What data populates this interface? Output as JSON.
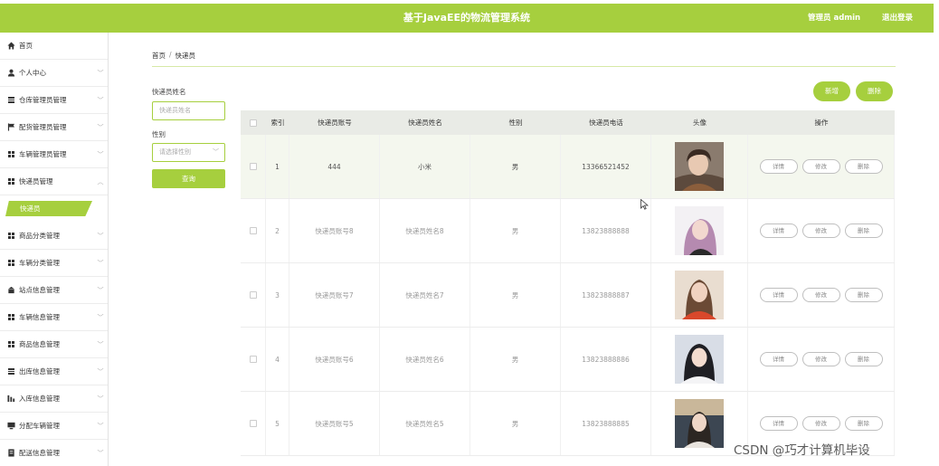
{
  "header": {
    "title": "基于JavaEE的物流管理系统",
    "admin_label": "管理员 admin",
    "logout_label": "退出登录",
    "bg_color": "#a6cf3e"
  },
  "sidebar": {
    "items": [
      {
        "label": "首页",
        "icon": "home-icon",
        "chevron": ""
      },
      {
        "label": "个人中心",
        "icon": "user-icon",
        "chevron": "﹀"
      },
      {
        "label": "仓库管理员管理",
        "icon": "list-icon",
        "chevron": "﹀"
      },
      {
        "label": "配货管理员管理",
        "icon": "flag-icon",
        "chevron": "﹀"
      },
      {
        "label": "车辆管理员管理",
        "icon": "grid-icon",
        "chevron": "﹀"
      },
      {
        "label": "快递员管理",
        "icon": "grid-icon",
        "chevron": "︿"
      },
      {
        "label": "商品分类管理",
        "icon": "grid-icon",
        "chevron": "﹀"
      },
      {
        "label": "车辆分类管理",
        "icon": "grid-icon",
        "chevron": "﹀"
      },
      {
        "label": "站点信息管理",
        "icon": "building-icon",
        "chevron": "﹀"
      },
      {
        "label": "车辆信息管理",
        "icon": "grid-icon",
        "chevron": "﹀"
      },
      {
        "label": "商品信息管理",
        "icon": "grid-icon",
        "chevron": "﹀"
      },
      {
        "label": "出库信息管理",
        "icon": "list-icon",
        "chevron": "﹀"
      },
      {
        "label": "入库信息管理",
        "icon": "bar-chart-icon",
        "chevron": "﹀"
      },
      {
        "label": "分配车辆管理",
        "icon": "monitor-icon",
        "chevron": "﹀"
      },
      {
        "label": "配送信息管理",
        "icon": "document-icon",
        "chevron": "﹀"
      }
    ],
    "active_sub": "快递员"
  },
  "breadcrumb": {
    "home": "首页",
    "sep": "/",
    "current": "快递员"
  },
  "filters": {
    "name_label": "快递员姓名",
    "name_placeholder": "快递员姓名",
    "gender_label": "性别",
    "gender_placeholder": "请选择性别",
    "query_label": "查询"
  },
  "actions": {
    "add_label": "新增",
    "delete_label": "删除"
  },
  "table": {
    "headers": [
      "索引",
      "快递员账号",
      "快递员姓名",
      "性别",
      "快递员电话",
      "头像",
      "操作"
    ],
    "rows": [
      {
        "index": "1",
        "account": "444",
        "name": "小米",
        "gender": "男",
        "phone": "13366521452",
        "avatar": "avatar-photo"
      },
      {
        "index": "2",
        "account": "快递员账号8",
        "name": "快递员姓名8",
        "gender": "男",
        "phone": "13823888888",
        "avatar": "avatar-photo"
      },
      {
        "index": "3",
        "account": "快递员账号7",
        "name": "快递员姓名7",
        "gender": "男",
        "phone": "13823888887",
        "avatar": "avatar-photo"
      },
      {
        "index": "4",
        "account": "快递员账号6",
        "name": "快递员姓名6",
        "gender": "男",
        "phone": "13823888886",
        "avatar": "avatar-photo"
      },
      {
        "index": "5",
        "account": "快递员账号5",
        "name": "快递员姓名5",
        "gender": "男",
        "phone": "13823888885",
        "avatar": "avatar-photo"
      }
    ],
    "op_labels": {
      "detail": "详情",
      "edit": "修改",
      "delete": "删除"
    }
  },
  "watermark": "CSDN @巧才计算机毕设"
}
